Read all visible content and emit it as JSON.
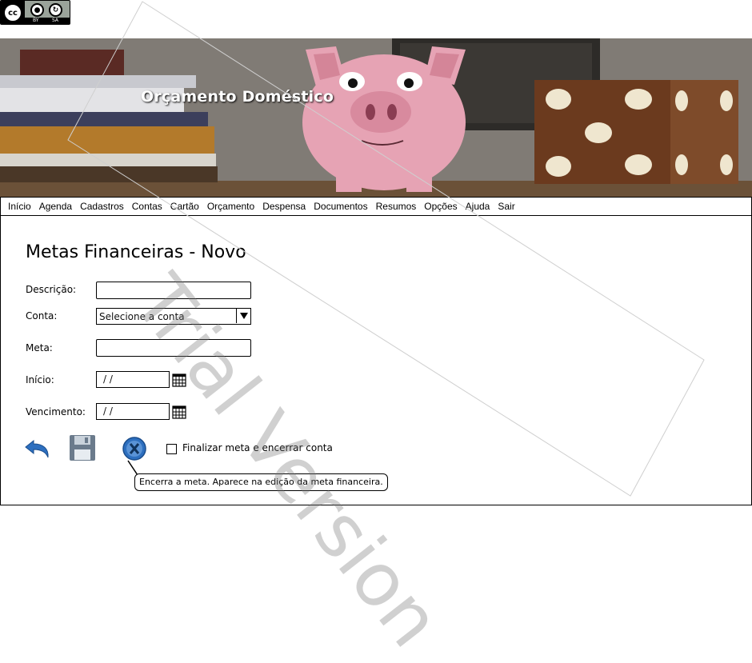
{
  "license_badge": {
    "label_by": "BY",
    "label_sa": "SA",
    "cc_text": "cc"
  },
  "banner": {
    "title": "Orçamento Doméstico"
  },
  "nav": {
    "items": [
      "Início",
      "Agenda",
      "Cadastros",
      "Contas",
      "Cartão",
      "Orçamento",
      "Despensa",
      "Documentos",
      "Resumos",
      "Opções",
      "Ajuda",
      "Sair"
    ]
  },
  "form": {
    "title": "Metas Financeiras - Novo",
    "descricao": {
      "label": "Descrição:",
      "value": ""
    },
    "conta": {
      "label": "Conta:",
      "selected": "Selecione a conta"
    },
    "meta": {
      "label": "Meta:",
      "value": ""
    },
    "inicio": {
      "label": "Início:",
      "value": " / /"
    },
    "vencimento": {
      "label": "Vencimento:",
      "value": " / /"
    },
    "finalizar_label": "Finalizar meta e encerrar conta",
    "finalizar_checked": false
  },
  "tooltip": {
    "text": "Encerra a meta. Aparece na edição da meta financeira."
  },
  "watermark": {
    "text": "Trial Version"
  },
  "colors": {
    "icon_blue": "#2d6fbf",
    "save_gray": "#6b7b8c",
    "accent_pink": "#e6a3b4"
  }
}
